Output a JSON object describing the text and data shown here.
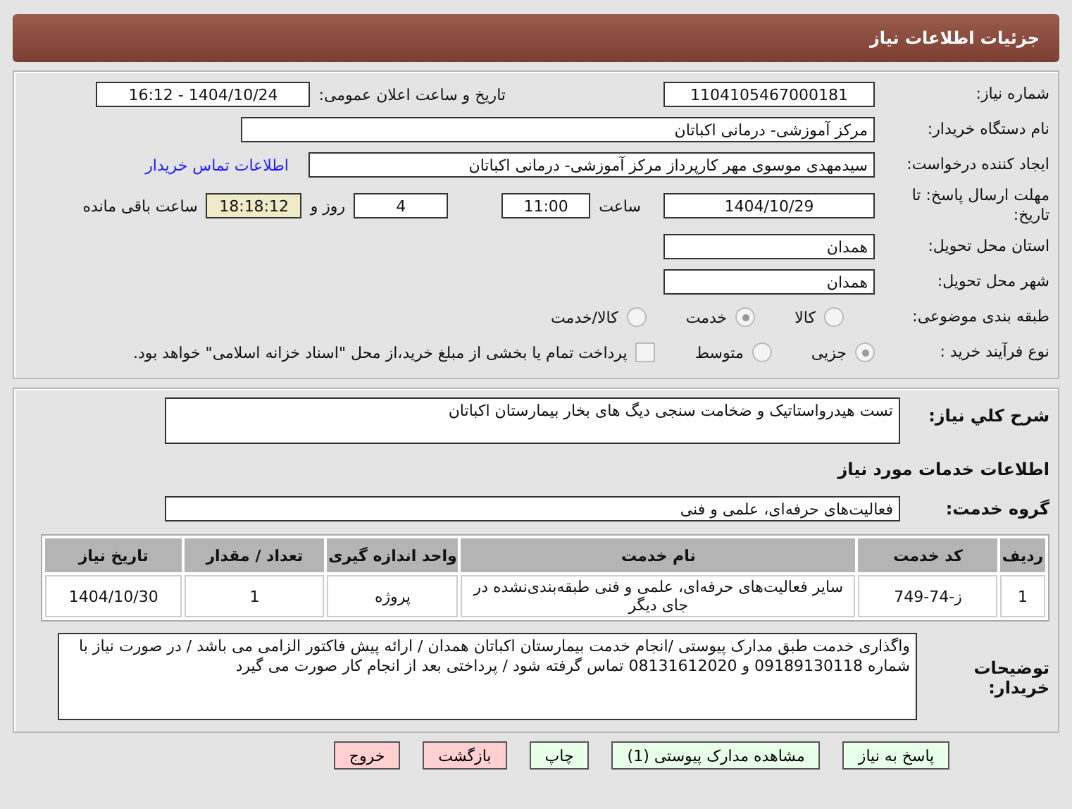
{
  "header": {
    "title": "جزئیات اطلاعات نیاز"
  },
  "need_number": {
    "label": "شماره نیاز:",
    "value": "1104105467000181"
  },
  "announce": {
    "label": "تاریخ و ساعت اعلان عمومی:",
    "value": "1404/10/24 - 16:12"
  },
  "buyer": {
    "label": "نام دستگاه خریدار:",
    "value": "مرکز آموزشی- درمانی اکباتان"
  },
  "creator": {
    "label": "ایجاد کننده درخواست:",
    "value": "سیدمهدی موسوی مهر کارپرداز مرکز آموزشی- درمانی اکباتان",
    "link": "اطلاعات تماس خریدار"
  },
  "deadline": {
    "label": "مهلت ارسال پاسخ: تا تاریخ:",
    "date": "1404/10/29",
    "time_label": "ساعت",
    "time": "11:00",
    "days": "4",
    "days_label": "روز و",
    "remaining": "18:18:12",
    "remaining_label": "ساعت باقی مانده"
  },
  "province": {
    "label": "استان محل تحویل:",
    "value": "همدان"
  },
  "city": {
    "label": "شهر محل تحویل:",
    "value": "همدان"
  },
  "category": {
    "label": "طبقه بندی موضوعی:",
    "options": [
      {
        "label": "کالا",
        "selected": false
      },
      {
        "label": "خدمت",
        "selected": true
      },
      {
        "label": "کالا/خدمت",
        "selected": false
      }
    ]
  },
  "process": {
    "label": "نوع فرآیند خرید :",
    "options": [
      {
        "label": "جزیی",
        "selected": true
      },
      {
        "label": "متوسط",
        "selected": false
      }
    ],
    "treasury": {
      "label": "پرداخت تمام یا بخشی از مبلغ خرید،از محل \"اسناد خزانه اسلامی\" خواهد بود.",
      "checked": false
    }
  },
  "description": {
    "label": "شرح کلي نياز:",
    "value": "تست هیدرواستاتیک و ضخامت سنجی دیگ های بخار بیمارستان اکباتان"
  },
  "services_heading": "اطلاعات خدمات مورد نیاز",
  "service_group": {
    "label": "گروه خدمت:",
    "value": "فعالیت‌های حرفه‌ای، علمی و فنی"
  },
  "table": {
    "columns": [
      "ردیف",
      "کد خدمت",
      "نام خدمت",
      "واحد اندازه گیری",
      "تعداد / مقدار",
      "تاریخ نیاز"
    ],
    "rows": [
      [
        "1",
        "ز-74-749",
        "سایر فعالیت‌های حرفه‌ای، علمی و فنی طبقه‌بندی‌نشده در جای دیگر",
        "پروژه",
        "1",
        "1404/10/30"
      ]
    ]
  },
  "buyer_notes": {
    "label": "توضیحات خریدار:",
    "value": "واگذاری خدمت طبق مدارک پیوستی /انجام خدمت بیمارستان اکباتان همدان / ارائه پیش فاکتور الزامی می باشد / در صورت نیاز با شماره 09189130118 و 08131612020 تماس گرفته شود / پرداختی بعد از انجام کار صورت می گیرد"
  },
  "buttons": [
    {
      "label": "پاسخ به نیاز",
      "kind": "primary"
    },
    {
      "label": "مشاهده مدارک پیوستی (1)",
      "kind": "primary"
    },
    {
      "label": "چاپ",
      "kind": "primary"
    },
    {
      "label": "بازگشت",
      "kind": "danger"
    },
    {
      "label": "خروج",
      "kind": "danger"
    }
  ]
}
